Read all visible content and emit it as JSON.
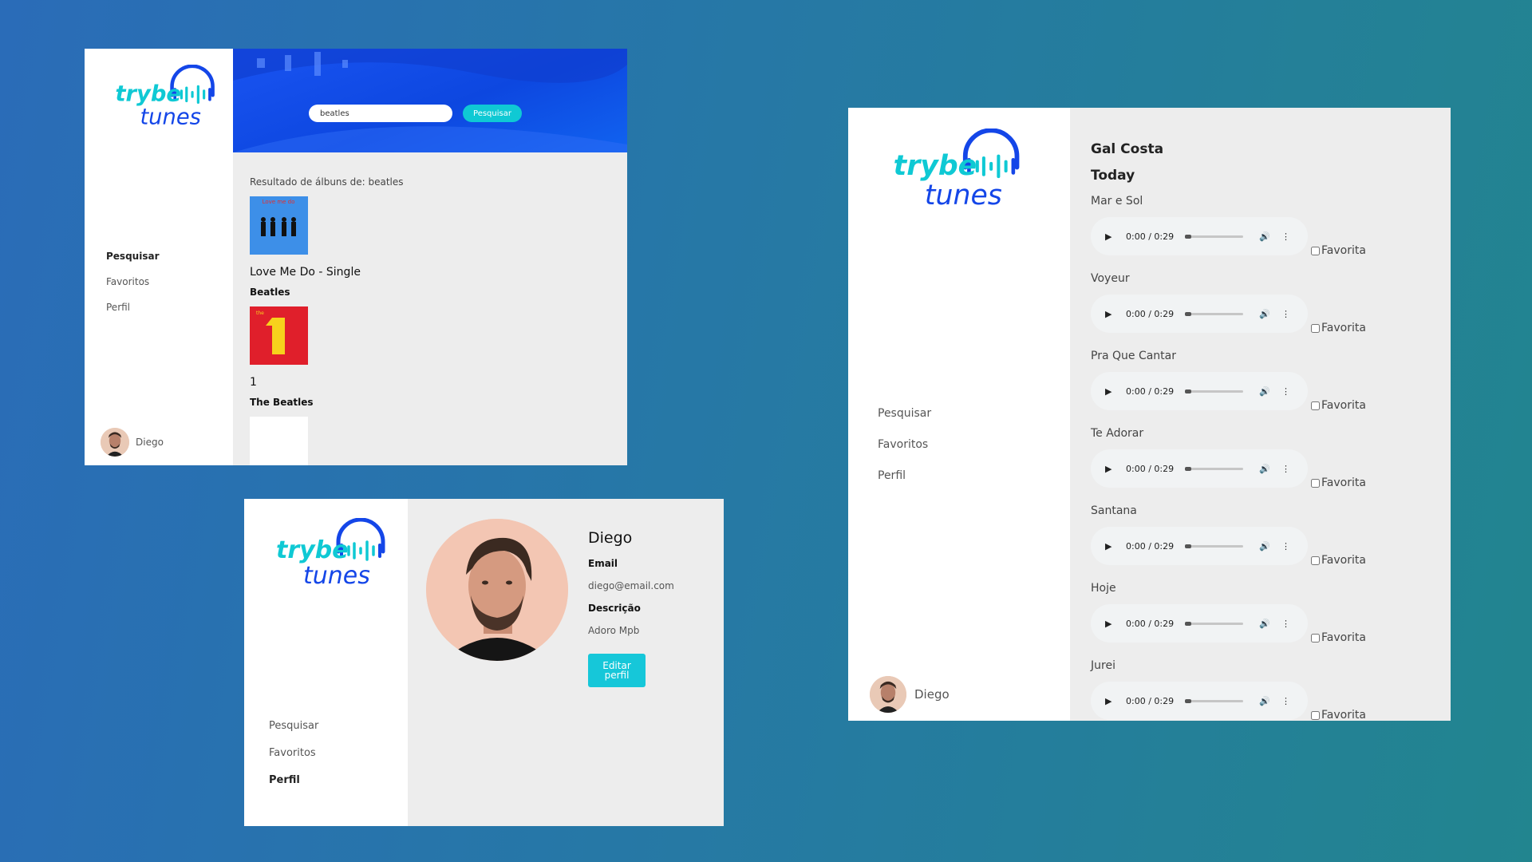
{
  "brand": {
    "line1": "trybe",
    "line2": "tunes",
    "primary": "#0fc9d4",
    "secondary": "#1446e8"
  },
  "search_screen": {
    "nav": [
      "Pesquisar",
      "Favoritos",
      "Perfil"
    ],
    "active_nav": "Pesquisar",
    "user_name": "Diego",
    "search_value": "beatles",
    "search_button": "Pesquisar",
    "result_heading": "Resultado de álbuns de: beatles",
    "albums": [
      {
        "title": "Love Me Do - Single",
        "artist": "Beatles",
        "cover_color": "#3d8fe8"
      },
      {
        "title": "1",
        "artist": "The Beatles",
        "cover_color": "#e01f2b"
      }
    ]
  },
  "profile_screen": {
    "nav": [
      "Pesquisar",
      "Favoritos",
      "Perfil"
    ],
    "active_nav": "Perfil",
    "name": "Diego",
    "email_label": "Email",
    "email": "diego@email.com",
    "description_label": "Descrição",
    "description": "Adoro Mpb",
    "edit_button": "Editar perfil"
  },
  "album_screen": {
    "nav": [
      "Pesquisar",
      "Favoritos",
      "Perfil"
    ],
    "user_name": "Diego",
    "artist": "Gal Costa",
    "album": "Today",
    "favorite_label": "Favorita",
    "player_time": "0:00 / 0:29",
    "tracks": [
      "Mar e Sol",
      "Voyeur",
      "Pra Que Cantar",
      "Te Adorar",
      "Santana",
      "Hoje",
      "Jurei"
    ]
  }
}
